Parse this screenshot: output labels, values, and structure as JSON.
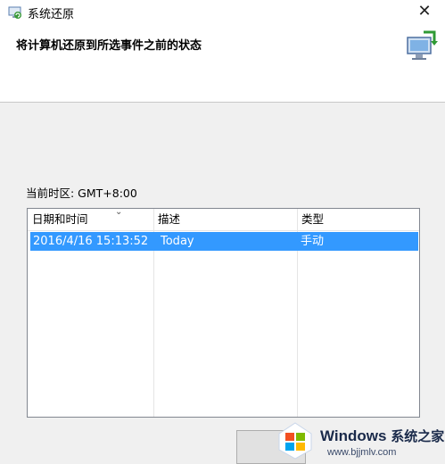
{
  "window": {
    "title": "系统还原",
    "close_glyph": "✕"
  },
  "header": {
    "title": "将计算机还原到所选事件之前的状态"
  },
  "timezone": {
    "label": "当前时区: GMT+8:00"
  },
  "restore_list": {
    "columns": [
      "日期和时间",
      "描述",
      "类型"
    ],
    "rows": [
      {
        "date_time": "2016/4/16 15:13:52",
        "description": "Today",
        "type": "手动",
        "selected": true
      }
    ]
  },
  "watermark": {
    "brand": "Windows",
    "brand_cn": "系统之家",
    "url": "www.bjjmlv.com"
  },
  "icons": {
    "app": "system-restore-icon",
    "header": "computer-restore-icon",
    "sort": "sort-caret-icon",
    "watermark": "windows-logo-icon"
  },
  "colors": {
    "selection": "#3399ff",
    "window_bg": "#f0f0f0"
  }
}
